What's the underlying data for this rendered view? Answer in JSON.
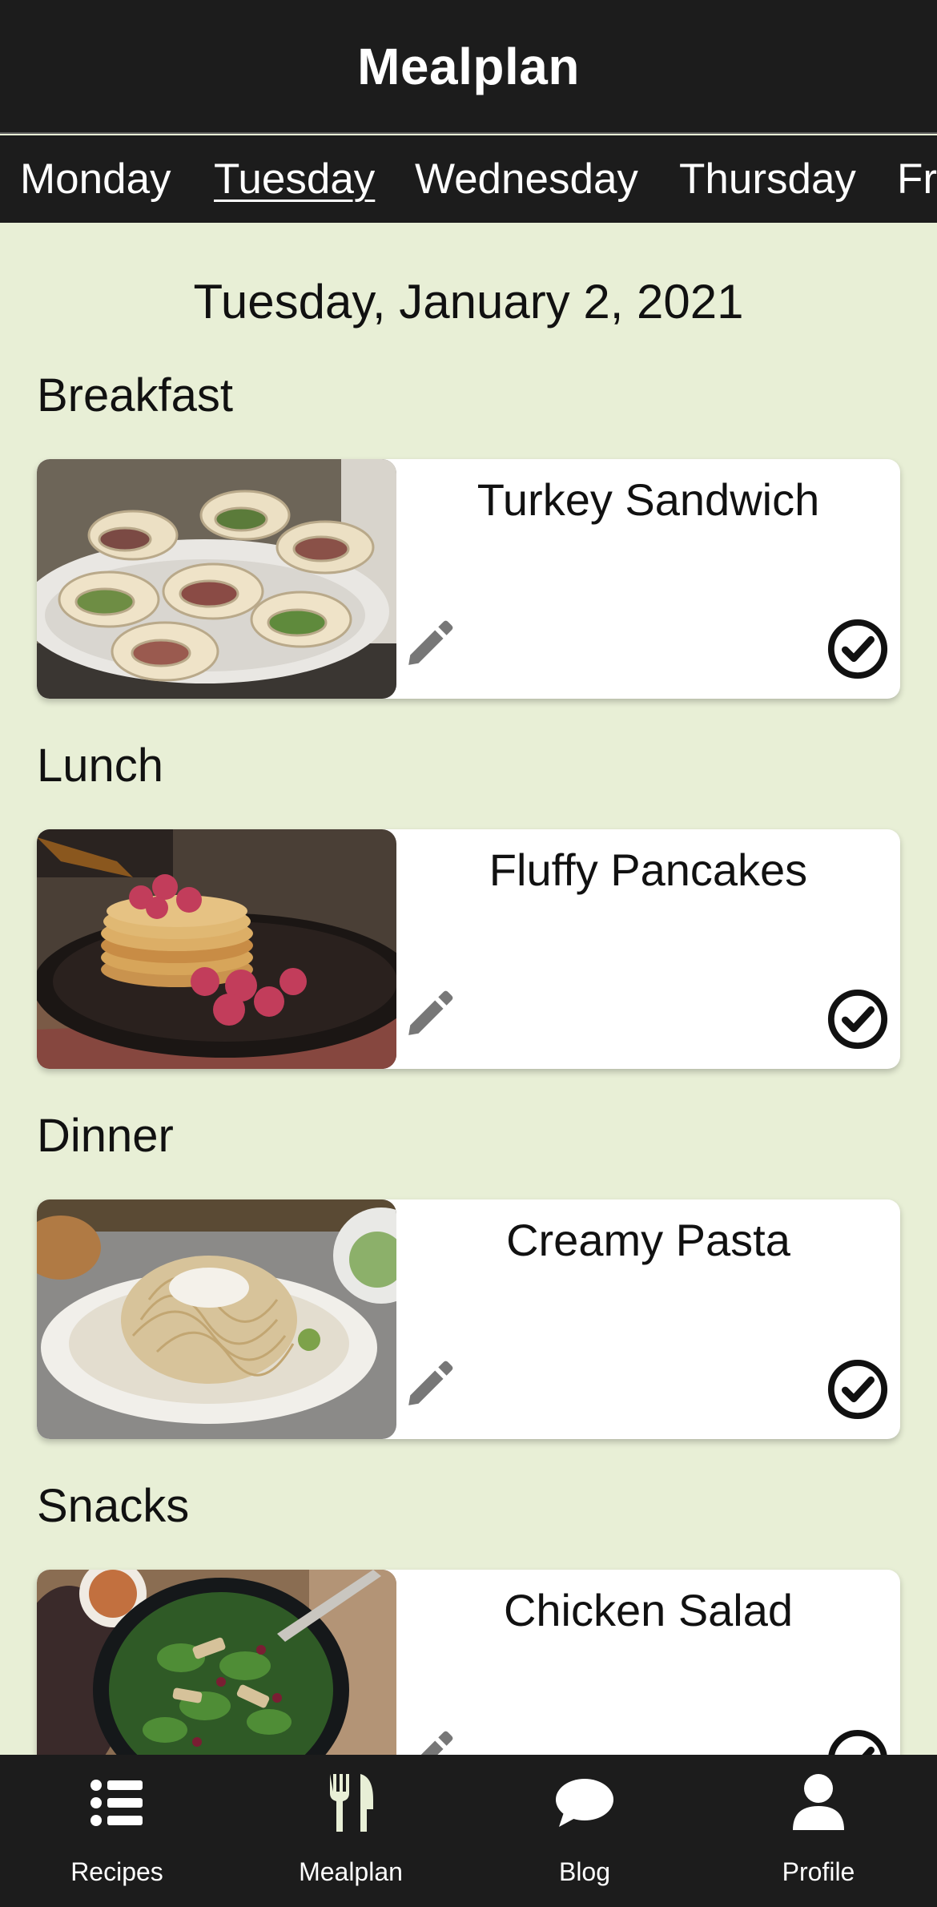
{
  "header": {
    "title": "Mealplan"
  },
  "days": [
    {
      "label": "Monday"
    },
    {
      "label": "Tuesday"
    },
    {
      "label": "Wednesday"
    },
    {
      "label": "Thursday"
    },
    {
      "label": "Fr"
    }
  ],
  "selected_day": "Tuesday",
  "date_heading": "Tuesday, January 2, 2021",
  "meals": [
    {
      "section": "Breakfast",
      "recipe": "Turkey Sandwich"
    },
    {
      "section": "Lunch",
      "recipe": "Fluffy Pancakes"
    },
    {
      "section": "Dinner",
      "recipe": "Creamy Pasta"
    },
    {
      "section": "Snacks",
      "recipe": "Chicken Salad"
    }
  ],
  "icons": {
    "edit": "pencil-icon",
    "done": "check-circle-icon"
  },
  "tabbar": [
    {
      "label": "Recipes",
      "icon": "list-icon"
    },
    {
      "label": "Mealplan",
      "icon": "fork-knife-icon",
      "active": true
    },
    {
      "label": "Blog",
      "icon": "chat-bubble-icon"
    },
    {
      "label": "Profile",
      "icon": "user-icon"
    }
  ],
  "colors": {
    "background": "#e8efd6",
    "header": "#1c1c1c",
    "active_tab_icon": "#e8efd6",
    "icon_gray": "#777777"
  }
}
